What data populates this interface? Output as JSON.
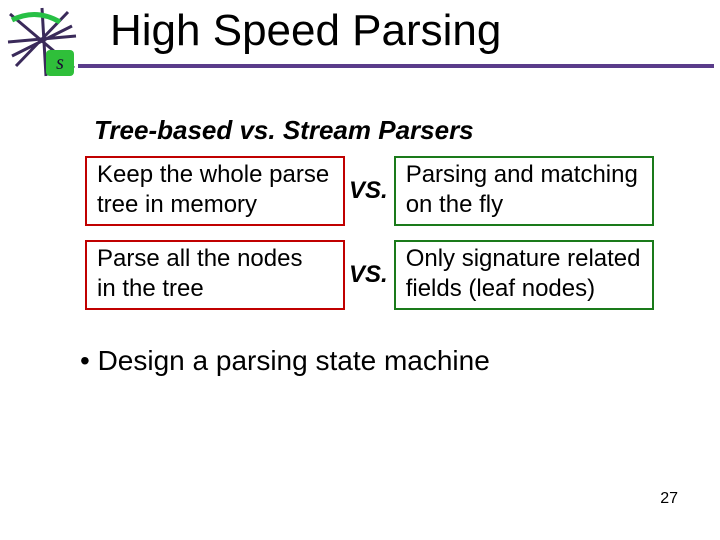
{
  "title": "High Speed Parsing",
  "subtitle": "Tree-based vs. Stream Parsers",
  "pairs": [
    {
      "left_line1": "Keep the whole parse",
      "left_line2": "tree in memory",
      "right_line1": "Parsing and matching",
      "right_line2": "on the fly"
    },
    {
      "left_line1": "Parse all the nodes",
      "left_line2": "in the tree",
      "right_line1": "Only signature related",
      "right_line2": "fields (leaf nodes)"
    }
  ],
  "vs_label": "VS.",
  "bullet": "•  Design a parsing state machine",
  "page_number": "27"
}
